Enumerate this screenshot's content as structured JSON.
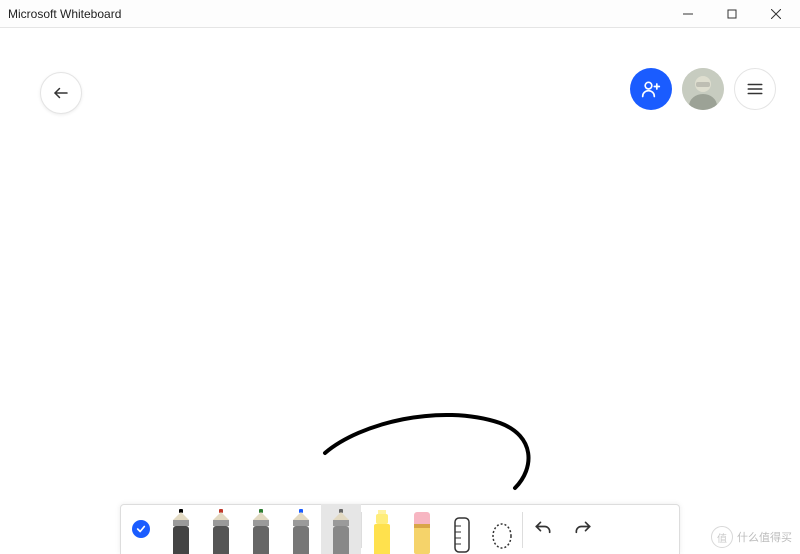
{
  "window": {
    "title": "Microsoft Whiteboard"
  },
  "topbar": {
    "back_icon": "back-arrow-icon",
    "share_icon": "person-add-icon",
    "avatar_icon": "user-avatar",
    "menu_icon": "hamburger-icon"
  },
  "toolbar": {
    "active_check_icon": "checkmark-icon",
    "pens": [
      {
        "name": "black-pen",
        "color": "#000000"
      },
      {
        "name": "red-pen",
        "color": "#c0392b"
      },
      {
        "name": "green-pen",
        "color": "#2e7d32"
      },
      {
        "name": "blue-pen",
        "color": "#1a5cff"
      },
      {
        "name": "gray-pen",
        "color": "#666666",
        "selected": true
      }
    ],
    "highlighter": "highlighter-yellow",
    "eraser": "eraser",
    "ruler_icon": "ruler-icon",
    "lasso_icon": "lasso-icon",
    "undo_icon": "undo-icon",
    "redo_icon": "redo-icon"
  },
  "watermark": {
    "badge": "值",
    "text": "什么值得买"
  }
}
